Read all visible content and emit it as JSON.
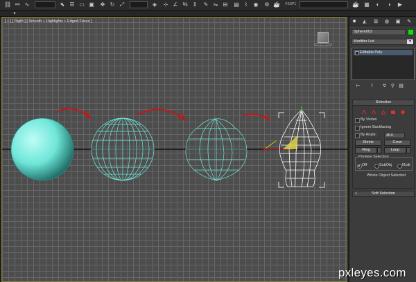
{
  "toolbar": {
    "label": "VSSP1",
    "icons": [
      "link-icon",
      "unlink-icon",
      "bind-icon",
      "select-icon",
      "select-name-icon",
      "rect-region-icon",
      "window-crossing-icon",
      "move-icon",
      "rotate-icon",
      "scale-icon",
      "view-icon",
      "pivot-icon",
      "snap-icon",
      "angle-snap-icon",
      "percent-snap-icon",
      "spinner-snap-icon",
      "edit-named-icon",
      "mirror-icon",
      "align-icon",
      "layer-icon",
      "graph-icon",
      "material-icon",
      "render-setup-icon",
      "render-icon"
    ]
  },
  "viewport": {
    "label": "[ + ] [ Right ] [ Smooth + Highlights + Edged Faces ]"
  },
  "panel": {
    "tabs": [
      "create-tab",
      "modify-tab",
      "hierarchy-tab",
      "motion-tab",
      "display-tab",
      "utilities-tab"
    ],
    "object_name": "Sphere003",
    "object_color": "#18d918",
    "modifier_list": "Modifier List",
    "stack_item": "Editable Poly",
    "selection": {
      "header": "Selection",
      "by_vertex": "By Vertex",
      "ignore_backfacing": "Ignore Backfacing",
      "by_angle": "By Angle:",
      "angle_value": "45.0",
      "shrink": "Shrink",
      "grow": "Grow",
      "ring": "Ring",
      "loop": "Loop",
      "preview_title": "Preview Selection",
      "preview_off": "Off",
      "preview_subobj": "SubObj",
      "preview_multi": "Multi",
      "status": "Whole Object Selected"
    },
    "soft_selection": {
      "header": "Soft Selection"
    }
  },
  "watermark": "pxleyes.com"
}
